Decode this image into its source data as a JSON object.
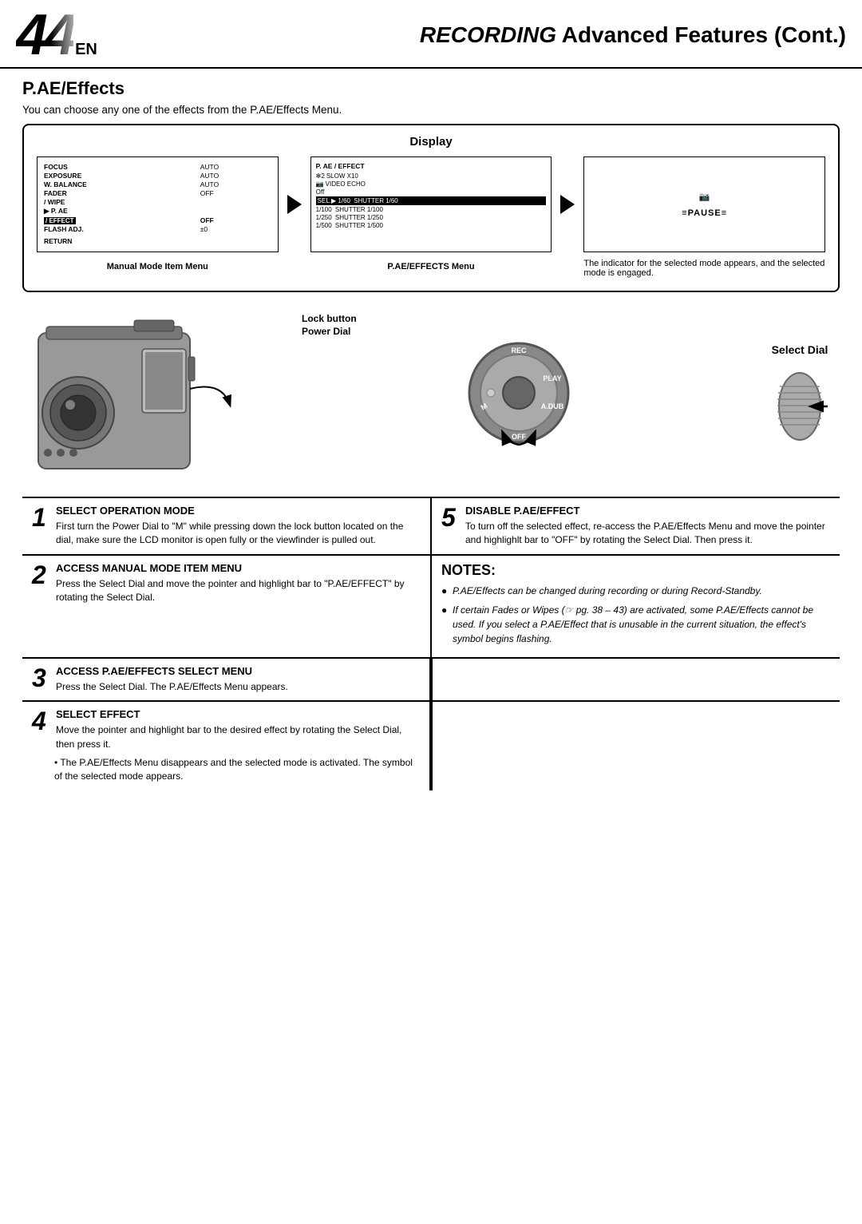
{
  "header": {
    "page_number": "44",
    "en_suffix": "EN",
    "title_italic": "RECORDING",
    "title_rest": " Advanced Features (Cont.)"
  },
  "section_title": "P.AE/Effects",
  "intro": "You can choose any one of the effects from the P.AE/Effects Menu.",
  "display_box": {
    "title": "Display",
    "panel_left_label": "Manual Mode Item Menu",
    "panel_middle_label": "P.AE/EFFECTS Menu",
    "panel_right_note": "The indicator for the selected mode appears, and the selected mode is engaged.",
    "manual_menu": [
      {
        "key": "FOCUS",
        "val": "AUTO"
      },
      {
        "key": "EXPOSURE",
        "val": "AUTO"
      },
      {
        "key": "W. BALANCE",
        "val": "AUTO"
      },
      {
        "key": "FADER",
        "val": "OFF"
      },
      {
        "key": "/ WIPE",
        "val": ""
      },
      {
        "key": "▶ P. AE",
        "val": ""
      },
      {
        "key": "/ EFFECT",
        "val": "OFF"
      },
      {
        "key": "FLASH ADJ.",
        "val": "±0"
      },
      {
        "key": "RETURN",
        "val": ""
      }
    ],
    "pae_menu_title": "P. AE / EFFECT",
    "pae_items": [
      {
        "icon": "✻2",
        "text": "SLOW X10"
      },
      {
        "icon": "🎬",
        "text": "VIDEO ECHO"
      },
      {
        "icon": "",
        "text": "Off"
      },
      {
        "highlight": true,
        "sel": "SEL. ▶ 1/60",
        "text": "SHUTTER 1/60"
      },
      {
        "sel": "1/100",
        "text": "SHUTTER 1/100"
      },
      {
        "sel": "1/250",
        "text": "SHUTTER 1/250"
      },
      {
        "sel": "1/500",
        "text": "SHUTTER 1/500"
      }
    ],
    "pause_label": "≡PAUSE≡"
  },
  "diagram": {
    "lock_button_label": "Lock button",
    "power_dial_label": "Power Dial",
    "select_dial_label": "Select Dial"
  },
  "steps": [
    {
      "number": "1",
      "heading": "SELECT OPERATION MODE",
      "text": "First turn the Power Dial to \"M\" while pressing down the lock button located on the dial, make sure the LCD monitor is open fully or the viewfinder is pulled out."
    },
    {
      "number": "2",
      "heading": "ACCESS MANUAL MODE ITEM MENU",
      "text": "Press the Select Dial and move the pointer and highlight bar to \"P.AE/EFFECT\" by rotating the Select Dial."
    },
    {
      "number": "3",
      "heading": "ACCESS P.AE/EFFECTS SELECT MENU",
      "text": "Press the Select Dial. The P.AE/Effects Menu appears."
    },
    {
      "number": "4",
      "heading": "SELECT EFFECT",
      "text": "Move the pointer and highlight bar to the desired effect by rotating the Select Dial, then press it.",
      "bullet": "The P.AE/Effects Menu disappears and the selected mode is activated. The symbol of the selected mode appears."
    }
  ],
  "step5": {
    "number": "5",
    "heading": "DISABLE P.AE/EFFECT",
    "text": "To turn off the selected effect, re-access the P.AE/Effects Menu and move the pointer and highlighlt bar to \"OFF\" by rotating the Select Dial. Then press it."
  },
  "notes_title": "NOTES:",
  "notes": [
    "P.AE/Effects can be changed during recording or during Record-Standby.",
    "If certain Fades or Wipes (☞ pg. 38 – 43) are activated, some P.AE/Effects cannot be used. If you select a P.AE/Effect that is unusable in the current situation, the effect's symbol begins flashing."
  ]
}
